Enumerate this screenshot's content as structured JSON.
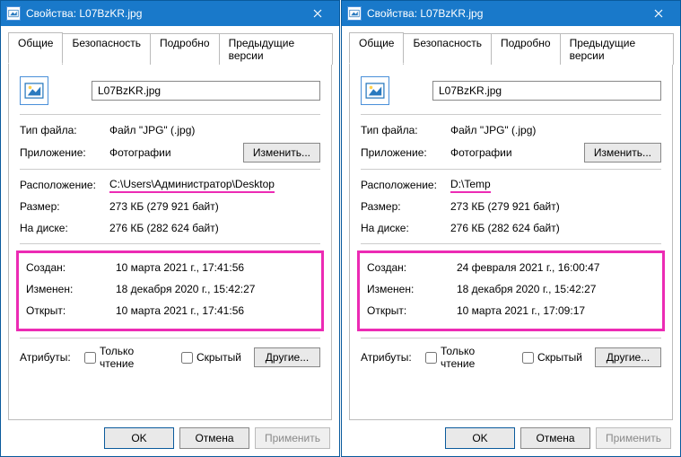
{
  "dialogs": [
    {
      "title": "Свойства: L07BzKR.jpg",
      "tabs": [
        "Общие",
        "Безопасность",
        "Подробно",
        "Предыдущие версии"
      ],
      "activeTab": 0,
      "filename": "L07BzKR.jpg",
      "labels": {
        "fileType": "Тип файла:",
        "application": "Приложение:",
        "location": "Расположение:",
        "size": "Размер:",
        "sizeOnDisk": "На диске:",
        "created": "Создан:",
        "modified": "Изменен:",
        "accessed": "Открыт:",
        "attributes": "Атрибуты:"
      },
      "values": {
        "fileType": "Файл \"JPG\" (.jpg)",
        "application": "Фотографии",
        "location": "C:\\Users\\Администратор\\Desktop",
        "size": "273 КБ (279 921 байт)",
        "sizeOnDisk": "276 КБ (282 624 байт)",
        "created": "10 марта 2021 г., 17:41:56",
        "modified": "18 декабря 2020 г., 15:42:27",
        "accessed": "10 марта 2021 г., 17:41:56"
      },
      "buttons": {
        "change": "Изменить...",
        "advanced": "Другие...",
        "ok": "OK",
        "cancel": "Отмена",
        "apply": "Применить"
      },
      "checkboxes": {
        "readonly": "Только чтение",
        "hidden": "Скрытый"
      }
    },
    {
      "title": "Свойства: L07BzKR.jpg",
      "tabs": [
        "Общие",
        "Безопасность",
        "Подробно",
        "Предыдущие версии"
      ],
      "activeTab": 0,
      "filename": "L07BzKR.jpg",
      "labels": {
        "fileType": "Тип файла:",
        "application": "Приложение:",
        "location": "Расположение:",
        "size": "Размер:",
        "sizeOnDisk": "На диске:",
        "created": "Создан:",
        "modified": "Изменен:",
        "accessed": "Открыт:",
        "attributes": "Атрибуты:"
      },
      "values": {
        "fileType": "Файл \"JPG\" (.jpg)",
        "application": "Фотографии",
        "location": "D:\\Temp",
        "size": "273 КБ (279 921 байт)",
        "sizeOnDisk": "276 КБ (282 624 байт)",
        "created": "24 февраля 2021 г., 16:00:47",
        "modified": "18 декабря 2020 г., 15:42:27",
        "accessed": "10 марта 2021 г., 17:09:17"
      },
      "buttons": {
        "change": "Изменить...",
        "advanced": "Другие...",
        "ok": "OK",
        "cancel": "Отмена",
        "apply": "Применить"
      },
      "checkboxes": {
        "readonly": "Только чтение",
        "hidden": "Скрытый"
      }
    }
  ]
}
